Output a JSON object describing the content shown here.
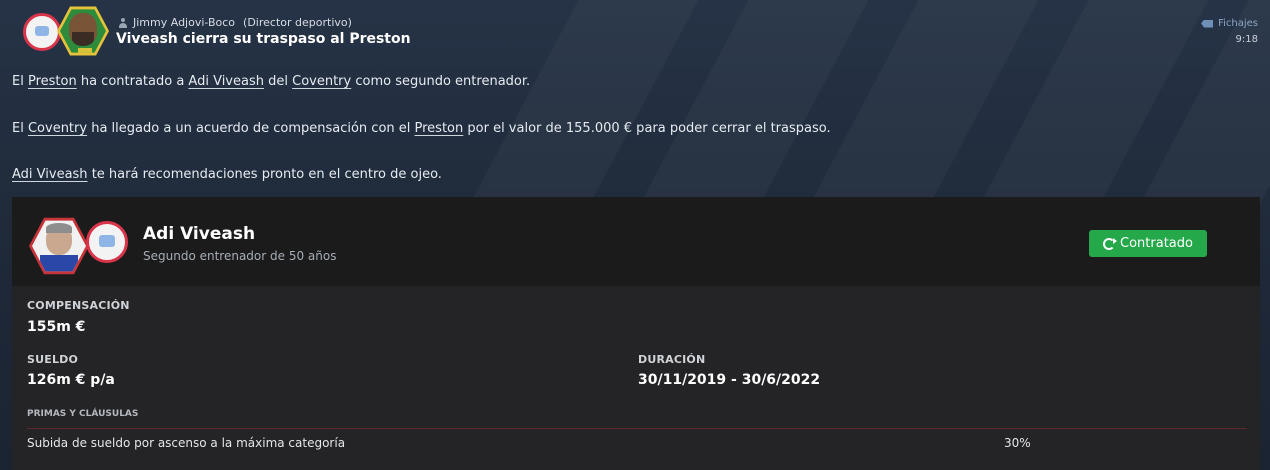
{
  "header": {
    "sender_name": "Jimmy Adjovi-Boco",
    "sender_role": "(Director deportivo)",
    "title": "Viveash cierra su traspaso al Preston",
    "category": "Fichajes",
    "time": "9:18"
  },
  "paragraphs": {
    "p1": {
      "t1": "El ",
      "club1": "Preston",
      "t2": " ha contratado a ",
      "person": "Adi Viveash",
      "t3": " del ",
      "club2": "Coventry",
      "t4": " como segundo entrenador."
    },
    "p2": {
      "t1": "El ",
      "club1": "Coventry",
      "t2": " ha llegado a un acuerdo de compensación con el ",
      "club2": "Preston",
      "t3": " por el valor de 155.000 € para poder cerrar el traspaso."
    },
    "p3": {
      "person": "Adi Viveash",
      "t1": " te hará recomendaciones pronto en el centro de ojeo."
    }
  },
  "card": {
    "name": "Adi Viveash",
    "subtitle": "Segundo entrenador de 50 años",
    "status_label": "Contratado",
    "status_color": "#25a84a",
    "compensation_label": "COMPENSACIÓN",
    "compensation_value": "155m €",
    "salary_label": "SUELDO",
    "salary_value": "126m € p/a",
    "duration_label": "DURACIÓN",
    "duration_value": "30/11/2019 - 30/6/2022",
    "bonuses_label": "PRIMAS Y CLÁUSULAS",
    "clauses": [
      {
        "text": "Subida de sueldo por ascenso a la máxima categoría",
        "value": "30%"
      }
    ]
  }
}
